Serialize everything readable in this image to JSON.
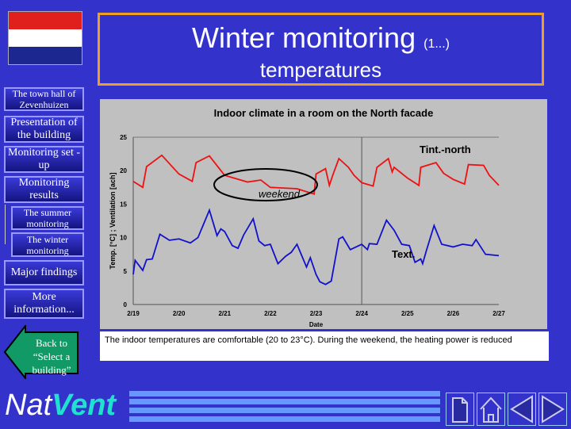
{
  "header": {
    "title": "Winter monitoring",
    "title_suffix": "(1...)",
    "subtitle": "temperatures"
  },
  "flag": {
    "colors": [
      "#e0201c",
      "#ffffff",
      "#1c2890"
    ]
  },
  "sidebar": {
    "items": [
      {
        "label": "The town hall of Zevenhuizen"
      },
      {
        "label": "Presentation of the building"
      },
      {
        "label": "Monitoring set -up"
      },
      {
        "label": "Monitoring results"
      },
      {
        "label": "The summer monitoring"
      },
      {
        "label": "The winter monitoring"
      },
      {
        "label": "Major findings"
      },
      {
        "label": "More information..."
      }
    ],
    "back_label": "Back to “Select a building”"
  },
  "caption": "The indoor temperatures are comfortable (20 to 23°C). During the weekend, the heating power is reduced",
  "footer": {
    "logo": "NatVent",
    "buttons": [
      "document-icon",
      "home-icon",
      "previous-icon",
      "next-icon"
    ]
  },
  "chart_data": {
    "type": "line",
    "title": "Indoor climate in a room on the North facade",
    "xlabel": "Date",
    "ylabel": "Temp. [°C] ; Ventilation [ach]",
    "ylim": [
      0,
      25
    ],
    "yticks": [
      0,
      5,
      10,
      15,
      20,
      25
    ],
    "xticks": [
      "2/19",
      "2/20",
      "2/21",
      "2/22",
      "2/23",
      "2/24",
      "2/25",
      "2/26",
      "2/27"
    ],
    "vline": "2/24 00:00",
    "annotations": {
      "weekend": "weekend",
      "tint": "Tint.-north",
      "text": "Text."
    },
    "series": [
      {
        "name": "Tint.-north",
        "color": "#ee1111",
        "points": [
          [
            "2/19 00:00",
            18.4
          ],
          [
            "2/19 05:00",
            17.5
          ],
          [
            "2/19 07:00",
            20.6
          ],
          [
            "2/19 15:00",
            22.3
          ],
          [
            "2/20 00:00",
            19.5
          ],
          [
            "2/20 07:00",
            18.4
          ],
          [
            "2/20 09:00",
            21.2
          ],
          [
            "2/20 16:00",
            22.2
          ],
          [
            "2/21 00:00",
            19.3
          ],
          [
            "2/21 12:00",
            18.3
          ],
          [
            "2/21 19:00",
            18.6
          ],
          [
            "2/22 00:00",
            17.5
          ],
          [
            "2/22 14:00",
            17.3
          ],
          [
            "2/22 23:00",
            16.5
          ],
          [
            "2/23 00:00",
            19.5
          ],
          [
            "2/23 05:00",
            20.3
          ],
          [
            "2/23 07:00",
            17.8
          ],
          [
            "2/23 09:00",
            19.5
          ],
          [
            "2/23 12:00",
            21.8
          ],
          [
            "2/23 17:00",
            20.5
          ],
          [
            "2/23 20:00",
            19.3
          ],
          [
            "2/24 00:00",
            18.2
          ],
          [
            "2/24 06:00",
            17.7
          ],
          [
            "2/24 08:00",
            20.5
          ],
          [
            "2/24 14:00",
            21.8
          ],
          [
            "2/24 16:00",
            19.8
          ],
          [
            "2/24 17:00",
            20.5
          ],
          [
            "2/25 00:00",
            18.9
          ],
          [
            "2/25 06:00",
            17.8
          ],
          [
            "2/25 07:00",
            20.5
          ],
          [
            "2/25 15:00",
            21.2
          ],
          [
            "2/25 19:00",
            19.6
          ],
          [
            "2/26 00:00",
            18.7
          ],
          [
            "2/26 06:00",
            18.0
          ],
          [
            "2/26 08:00",
            20.9
          ],
          [
            "2/26 16:00",
            20.8
          ],
          [
            "2/26 19:00",
            19.3
          ],
          [
            "2/27 00:00",
            17.8
          ]
        ]
      },
      {
        "name": "Text.",
        "color": "#1111cc",
        "points": [
          [
            "2/19 00:00",
            4.5
          ],
          [
            "2/19 01:00",
            6.6
          ],
          [
            "2/19 05:00",
            5.1
          ],
          [
            "2/19 07:00",
            6.7
          ],
          [
            "2/19 10:00",
            6.8
          ],
          [
            "2/19 14:00",
            10.5
          ],
          [
            "2/19 19:00",
            9.6
          ],
          [
            "2/20 00:00",
            9.8
          ],
          [
            "2/20 06:00",
            9.2
          ],
          [
            "2/20 10:00",
            10.0
          ],
          [
            "2/20 16:00",
            14.1
          ],
          [
            "2/20 20:00",
            10.3
          ],
          [
            "2/20 22:00",
            11.3
          ],
          [
            "2/21 00:00",
            10.9
          ],
          [
            "2/21 04:00",
            8.8
          ],
          [
            "2/21 07:00",
            8.4
          ],
          [
            "2/21 10:00",
            10.4
          ],
          [
            "2/21 15:00",
            12.8
          ],
          [
            "2/21 18:00",
            9.5
          ],
          [
            "2/21 21:00",
            8.8
          ],
          [
            "2/22 00:00",
            9.0
          ],
          [
            "2/22 04:00",
            6.1
          ],
          [
            "2/22 08:00",
            7.2
          ],
          [
            "2/22 11:00",
            7.8
          ],
          [
            "2/22 14:00",
            9.0
          ],
          [
            "2/22 19:00",
            5.6
          ],
          [
            "2/22 21:00",
            7.0
          ],
          [
            "2/23 00:00",
            4.5
          ],
          [
            "2/23 02:00",
            3.4
          ],
          [
            "2/23 05:00",
            3.0
          ],
          [
            "2/23 08:00",
            3.5
          ],
          [
            "2/23 12:00",
            9.8
          ],
          [
            "2/23 14:00",
            10.1
          ],
          [
            "2/23 18:00",
            8.2
          ],
          [
            "2/24 00:00",
            9.0
          ],
          [
            "2/24 03:00",
            8.2
          ],
          [
            "2/24 04:00",
            9.1
          ],
          [
            "2/24 08:00",
            9.0
          ],
          [
            "2/24 13:00",
            12.6
          ],
          [
            "2/24 17:00",
            11.1
          ],
          [
            "2/24 21:00",
            9.0
          ],
          [
            "2/25 01:00",
            8.8
          ],
          [
            "2/25 04:00",
            6.3
          ],
          [
            "2/25 07:00",
            6.8
          ],
          [
            "2/25 08:00",
            6.1
          ],
          [
            "2/25 10:00",
            8.1
          ],
          [
            "2/25 14:00",
            11.8
          ],
          [
            "2/25 18:00",
            9.0
          ],
          [
            "2/26 00:00",
            8.6
          ],
          [
            "2/26 05:00",
            9.0
          ],
          [
            "2/26 10:00",
            8.8
          ],
          [
            "2/26 12:00",
            9.7
          ],
          [
            "2/26 17:00",
            7.5
          ],
          [
            "2/27 00:00",
            7.3
          ]
        ]
      }
    ]
  }
}
